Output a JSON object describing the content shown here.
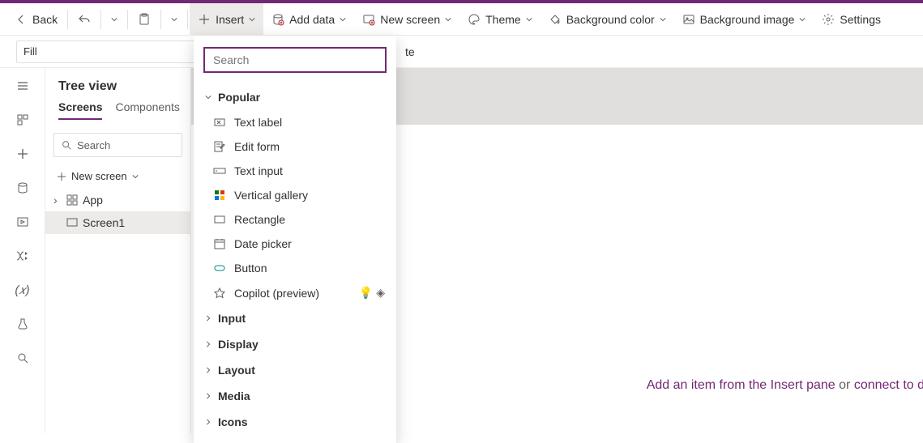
{
  "toolbar": {
    "back": "Back",
    "insert": "Insert",
    "add_data": "Add data",
    "new_screen": "New screen",
    "theme": "Theme",
    "bg_color": "Background color",
    "bg_image": "Background image",
    "settings": "Settings"
  },
  "formula": {
    "property": "Fill",
    "value": "te"
  },
  "tree": {
    "title": "Tree view",
    "tab_screens": "Screens",
    "tab_components": "Components",
    "search_placeholder": "Search",
    "new_screen": "New screen",
    "app": "App",
    "screen1": "Screen1"
  },
  "insert_panel": {
    "search_placeholder": "Search",
    "popular": "Popular",
    "items": {
      "text_label": "Text label",
      "edit_form": "Edit form",
      "text_input": "Text input",
      "vertical_gallery": "Vertical gallery",
      "rectangle": "Rectangle",
      "date_picker": "Date picker",
      "button": "Button",
      "copilot": "Copilot (preview)"
    },
    "groups": {
      "input": "Input",
      "display": "Display",
      "layout": "Layout",
      "media": "Media",
      "icons": "Icons"
    }
  },
  "canvas": {
    "hint_pre": "Add an item from the Insert pane",
    "hint_or": " or ",
    "hint_link": "connect to d"
  }
}
